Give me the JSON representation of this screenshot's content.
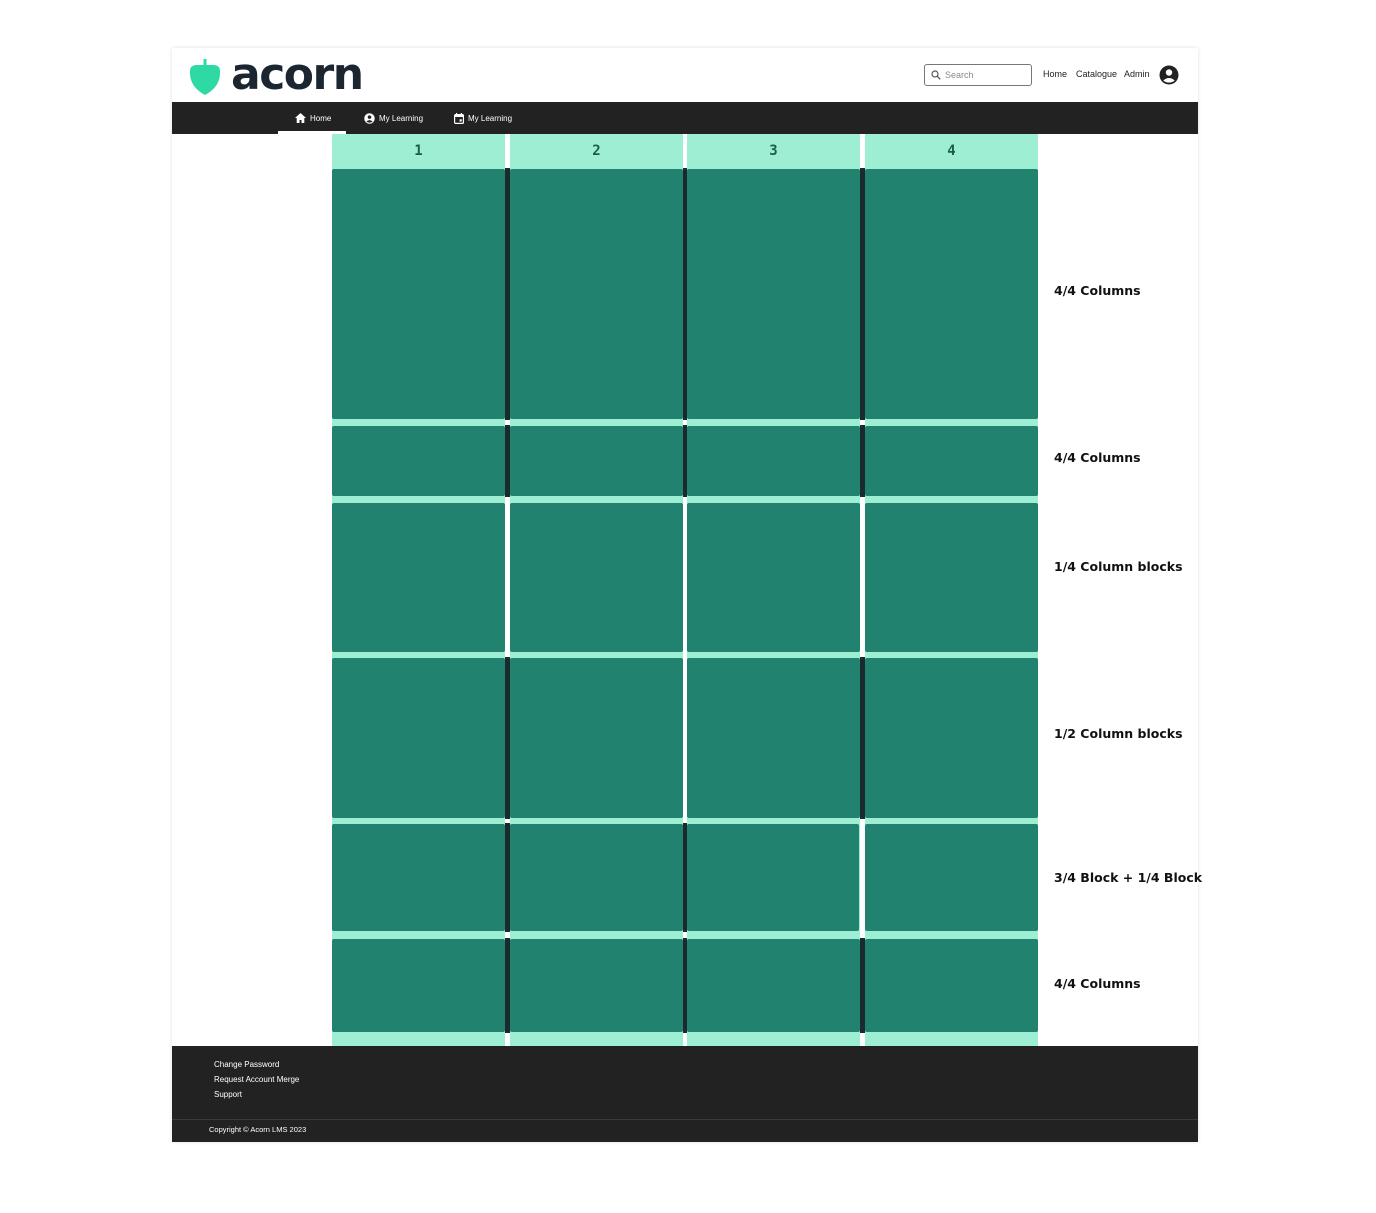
{
  "header": {
    "brand": "acorn",
    "search_placeholder": "Search",
    "nav": {
      "home": "Home",
      "catalogue": "Catalogue",
      "admin": "Admin"
    }
  },
  "tabs": [
    {
      "label": "Home",
      "icon": "home-icon",
      "active": true
    },
    {
      "label": "My Learning",
      "icon": "account-circle-icon",
      "active": false
    },
    {
      "label": "My Learning",
      "icon": "calendar-icon",
      "active": false
    }
  ],
  "grid": {
    "columns": [
      "1",
      "2",
      "3",
      "4"
    ],
    "rows": [
      {
        "label": "4/4 Columns"
      },
      {
        "label": "4/4 Columns"
      },
      {
        "label": "1/4 Column blocks"
      },
      {
        "label": "1/2 Column blocks"
      },
      {
        "label": "3/4 Block + 1/4 Block"
      },
      {
        "label": "4/4 Columns"
      }
    ]
  },
  "footer": {
    "links": [
      "Change Password",
      "Request Account Merge",
      "Support"
    ],
    "copyright": "Copyright © Acorn LMS 2023"
  },
  "colors": {
    "brand_green": "#2ed9a4",
    "block_green": "#218270",
    "column_header": "#9eeed3",
    "dark_bar": "#222222",
    "logo_text": "#1c2630"
  }
}
